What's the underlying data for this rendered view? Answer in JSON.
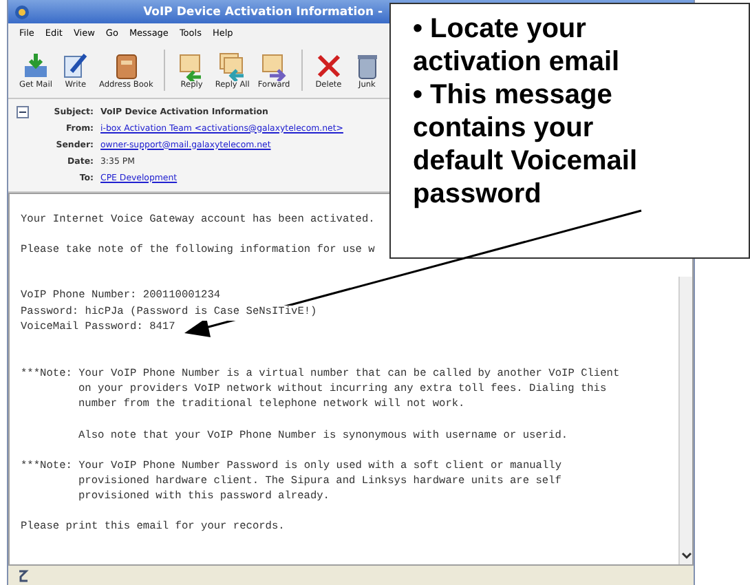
{
  "window": {
    "title": "VoIP Device Activation Information -"
  },
  "menu": [
    "File",
    "Edit",
    "View",
    "Go",
    "Message",
    "Tools",
    "Help"
  ],
  "toolbar": [
    {
      "label": "Get Mail",
      "kind": "getmail"
    },
    {
      "label": "Write",
      "kind": "write"
    },
    {
      "label": "Address Book",
      "kind": "book"
    },
    {
      "label": "Reply",
      "kind": "reply"
    },
    {
      "label": "Reply All",
      "kind": "replyall"
    },
    {
      "label": "Forward",
      "kind": "forward"
    },
    {
      "label": "Delete",
      "kind": "delete"
    },
    {
      "label": "Junk",
      "kind": "junk"
    }
  ],
  "headers": [
    {
      "label": "Subject:",
      "value": "VoIP Device Activation Information",
      "kind": "bold"
    },
    {
      "label": "From:",
      "value": "i-box Activation Team <activations@galaxytelecom.net>",
      "kind": "link"
    },
    {
      "label": "Sender:",
      "value": "owner-support@mail.galaxytelecom.net",
      "kind": "link"
    },
    {
      "label": "Date:",
      "value": "3:35 PM",
      "kind": "plain"
    },
    {
      "label": "To:",
      "value": "CPE Development",
      "kind": "link"
    }
  ],
  "body": [
    {
      "kind": "plain",
      "lines": [
        "Your Internet Voice Gateway account has been activated."
      ]
    },
    {
      "kind": "plain",
      "lines": [
        "Please take note of the following information for use w"
      ]
    },
    {
      "kind": "plain",
      "lines": [
        "VoIP Phone Number: 200110001234",
        "Password: hicPJa (Password is Case SeNsITivE!)",
        "VoiceMail Password: 8417"
      ]
    },
    {
      "kind": "note",
      "lines": [
        "***Note: Your VoIP Phone Number is a virtual number that can be called by another VoIP Client",
        "on your providers VoIP network without incurring any extra toll fees. Dialing this",
        "number from the traditional telephone network will not work."
      ]
    },
    {
      "kind": "indented",
      "lines": [
        "Also note that your VoIP Phone Number is synonymous with username or userid."
      ]
    },
    {
      "kind": "note",
      "lines": [
        "***Note: Your VoIP Phone Number Password is only used with a soft client or manually",
        "provisioned hardware client. The Sipura and Linksys hardware units are self",
        "provisioned with this password already."
      ]
    },
    {
      "kind": "plain",
      "lines": [
        "Please print this email for your records."
      ]
    }
  ],
  "callout": [
    "• Locate your activation email",
    "• This message contains your default Voicemail password"
  ]
}
